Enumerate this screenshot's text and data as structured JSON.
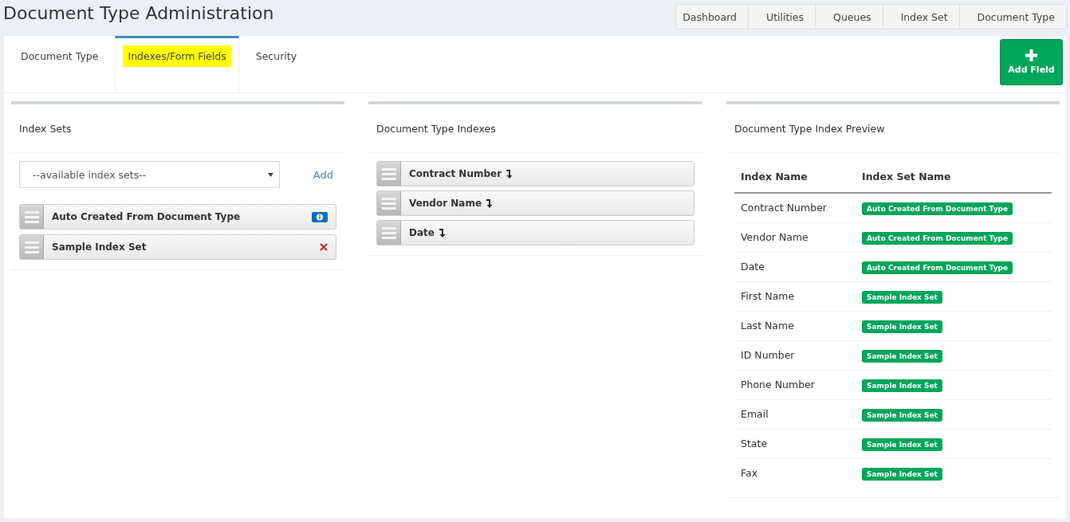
{
  "page_title": "Document Type Administration",
  "breadcrumb": [
    "Dashboard",
    "Utilities",
    "Queues",
    "Index Set",
    "Document Type"
  ],
  "tabs": [
    {
      "label": "Document Type",
      "selected": false,
      "highlighted": false
    },
    {
      "label": "Indexes/Form Fields",
      "selected": true,
      "highlighted": true
    },
    {
      "label": "Security",
      "selected": false,
      "highlighted": false
    }
  ],
  "add_button": {
    "label": "Add Field"
  },
  "index_sets_panel": {
    "title": "Index Sets",
    "select": {
      "placeholder": "--available index sets--"
    },
    "add_link": "Add",
    "items": [
      {
        "label": "Auto Created From Document Type",
        "kind": "info"
      },
      {
        "label": "Sample Index Set",
        "kind": "remove"
      }
    ]
  },
  "indexes_panel": {
    "title": "Document Type Indexes",
    "items": [
      "Contract Number",
      "Vendor Name",
      "Date"
    ]
  },
  "preview_panel": {
    "title": "Document Type Index Preview",
    "columns": [
      "Index Name",
      "Index Set Name"
    ],
    "rows": [
      {
        "name": "Contract Number",
        "set": "Auto Created From Document Type"
      },
      {
        "name": "Vendor Name",
        "set": "Auto Created From Document Type"
      },
      {
        "name": "Date",
        "set": "Auto Created From Document Type"
      },
      {
        "name": "First Name",
        "set": "Sample Index Set"
      },
      {
        "name": "Last Name",
        "set": "Sample Index Set"
      },
      {
        "name": "ID Number",
        "set": "Sample Index Set"
      },
      {
        "name": "Phone Number",
        "set": "Sample Index Set"
      },
      {
        "name": "Email",
        "set": "Sample Index Set"
      },
      {
        "name": "State",
        "set": "Sample Index Set"
      },
      {
        "name": "Fax",
        "set": "Sample Index Set"
      }
    ]
  }
}
